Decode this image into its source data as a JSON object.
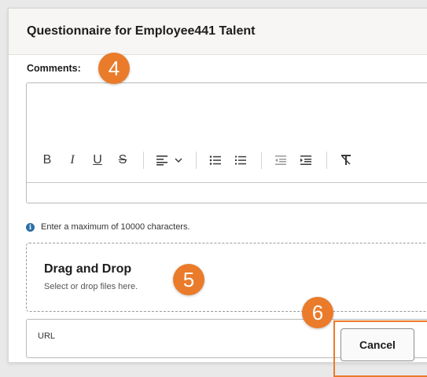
{
  "dialog": {
    "title": "Questionnaire for Employee441 Talent",
    "comments_label": "Comments:"
  },
  "editor": {
    "toolbar": {
      "bold": "B",
      "italic": "I",
      "underline": "U",
      "strikethrough": "S"
    }
  },
  "hint": {
    "icon": "info-icon",
    "text": "Enter a maximum of 10000 characters."
  },
  "dropzone": {
    "title": "Drag and Drop",
    "subtitle": "Select or drop files here."
  },
  "url_field": {
    "placeholder": "URL"
  },
  "actions": {
    "cancel_label": "Cancel"
  },
  "annotations": {
    "badge_4": "4",
    "badge_5": "5",
    "badge_6": "6",
    "color": "#ea7b2a"
  }
}
